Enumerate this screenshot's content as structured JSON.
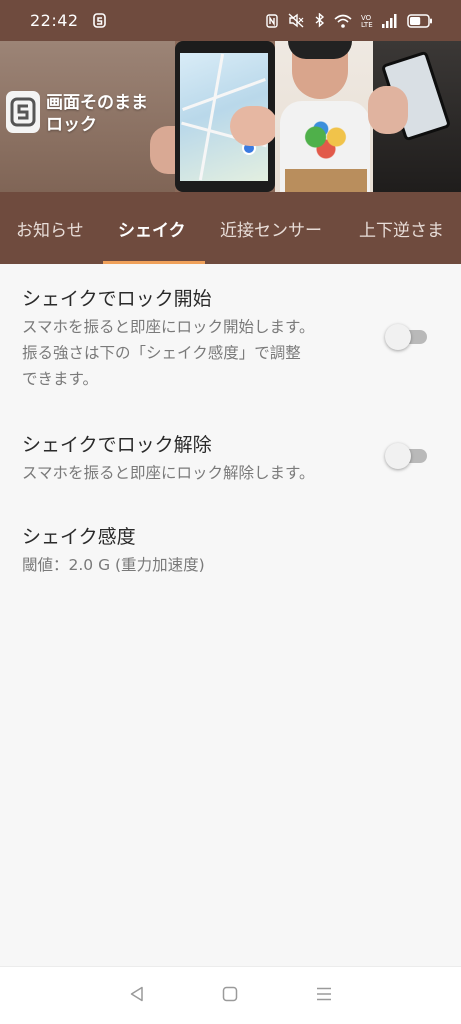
{
  "status_bar": {
    "time": "22:42",
    "icons": [
      "app-s-icon",
      "nfc-icon",
      "mute-icon",
      "bluetooth-icon",
      "wifi-icon",
      "volte-icon",
      "signal-icon",
      "battery-icon"
    ],
    "battery_level": 0.6
  },
  "banner": {
    "title_line1": "画面そのまま",
    "title_line2": "ロック"
  },
  "tabs": {
    "items": [
      {
        "label": "お知らせ"
      },
      {
        "label": "シェイク"
      },
      {
        "label": "近接センサー"
      },
      {
        "label": "上下逆さま"
      }
    ],
    "active_index": 1,
    "indicator_color": "#f0a15a"
  },
  "settings": [
    {
      "title": "シェイクでロック開始",
      "desc_lines": [
        "スマホを振ると即座にロック開始します。",
        "振る強さは下の「シェイク感度」で調整",
        "できます。"
      ],
      "enabled": false
    },
    {
      "title": "シェイクでロック解除",
      "desc_lines": [
        "スマホを振ると即座にロック解除します。"
      ],
      "enabled": false
    },
    {
      "title": "シェイク感度",
      "desc_lines": [
        "閾値：2.0 G (重力加速度)"
      ]
    }
  ],
  "nav": {
    "icons": [
      "back-icon",
      "home-icon",
      "menu-icon"
    ]
  },
  "colors": {
    "header_brown": "#6f4b3e",
    "background": "#f7f7f7",
    "accent_orange": "#f0a15a"
  }
}
